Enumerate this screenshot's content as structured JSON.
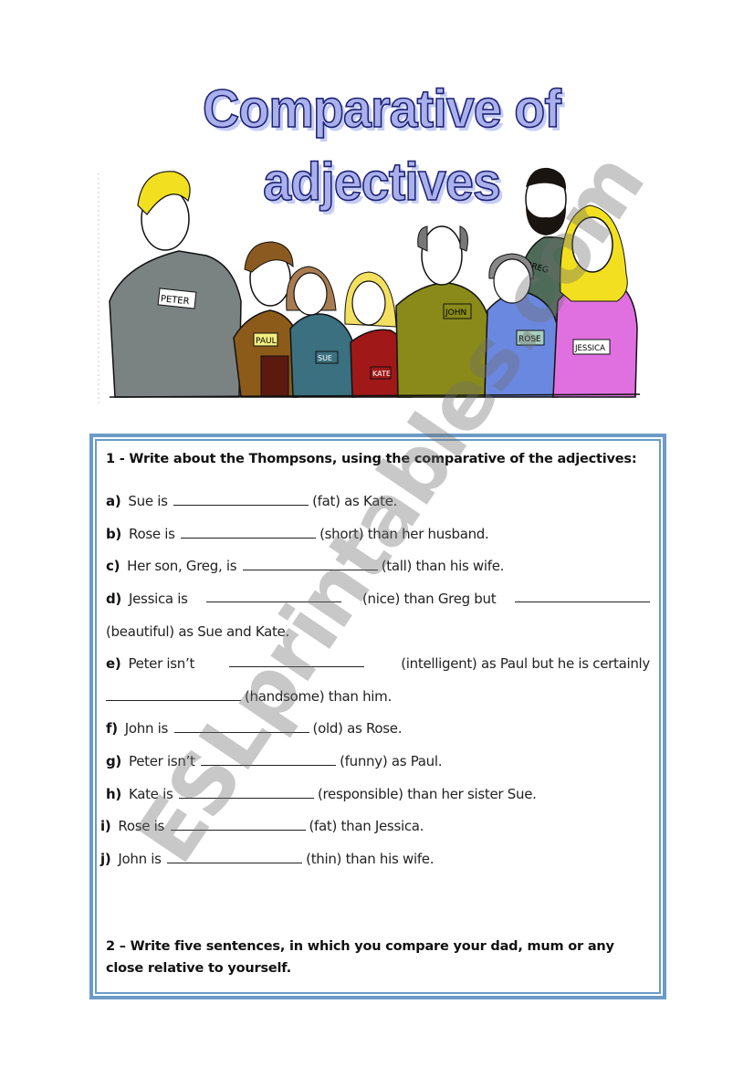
{
  "title": "Comparative of adjectives",
  "illustration": {
    "description": "family-cartoon",
    "name_tags": [
      "PETER",
      "PAUL",
      "SUE",
      "KATE",
      "JOHN",
      "ROSE",
      "GREG",
      "JESSICA"
    ]
  },
  "exercise1": {
    "heading": "1 - Write about the Thompsons, using the comparative of the adjectives:",
    "items": [
      {
        "label": "a)",
        "before": "Sue is",
        "hint": "(fat) as Kate."
      },
      {
        "label": "b)",
        "before": "Rose is",
        "hint": "(short) than her husband."
      },
      {
        "label": "c)",
        "before": "Her son, Greg, is",
        "hint": "(tall) than his wife."
      },
      {
        "label": "d)",
        "before": "Jessica  is",
        "middle": "(nice)  than  Greg  but",
        "continuation": "(beautiful) as Sue and Kate."
      },
      {
        "label": "e)",
        "before": "Peter isn’t",
        "middle": "(intelligent) as Paul but he is certainly",
        "continuation": "(handsome) than him."
      },
      {
        "label": "f)",
        "before": "John is",
        "hint": "(old) as Rose."
      },
      {
        "label": "g)",
        "before": "Peter isn’t",
        "hint": "(funny) as Paul."
      },
      {
        "label": "h)",
        "before": "Kate is",
        "hint": "(responsible) than her sister Sue."
      },
      {
        "label": "i)",
        "before": "Rose is",
        "hint": "(fat) than Jessica."
      },
      {
        "label": "j)",
        "before": "John is",
        "hint": "(thin) than his wife."
      }
    ]
  },
  "exercise2": {
    "heading_line1": "2 – Write five sentences, in which you compare your dad, mum or any",
    "heading_line2": "close relative to yourself."
  },
  "watermark": "ESLprintables.com",
  "colors": {
    "title_fill": "#aab0ec",
    "title_outline": "#1c2272",
    "box_border": "#6b9bc6"
  }
}
